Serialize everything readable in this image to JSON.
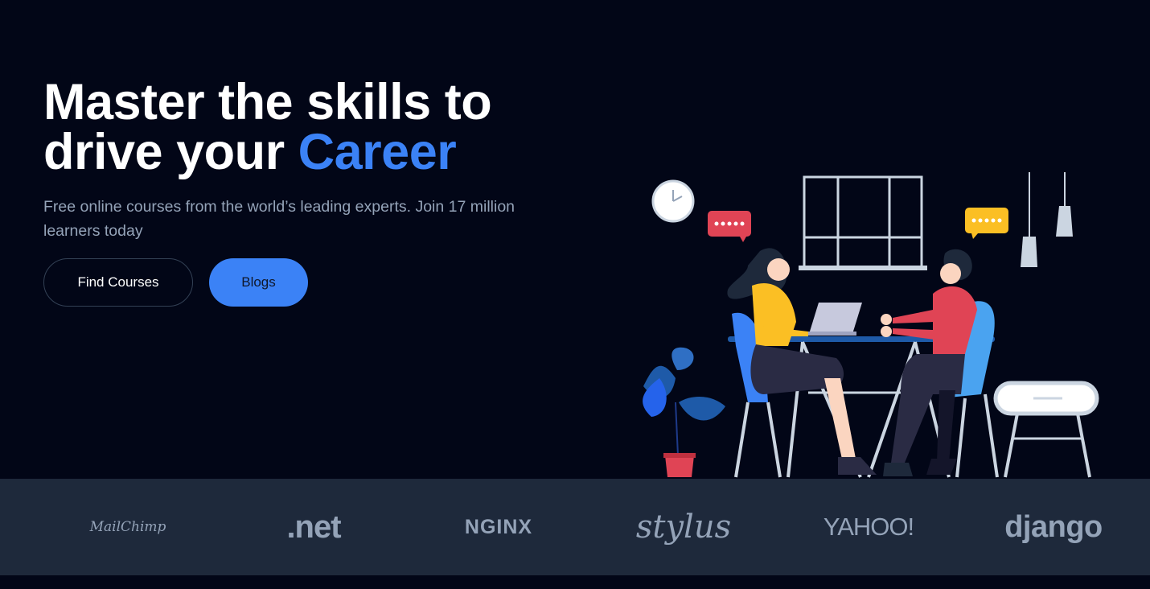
{
  "hero": {
    "headline_line1": "Master the skills to",
    "headline_line2_prefix": "drive your ",
    "headline_accent": "Career",
    "subtitle": "Free online courses from the world’s leading experts. Join 17 million learners today",
    "buttons": {
      "find_courses": "Find Courses",
      "blogs": "Blogs"
    }
  },
  "brands": [
    "MailChimp",
    ".net",
    "NGINX",
    "stylus",
    "YAHOO!",
    "django"
  ],
  "colors": {
    "background": "#020617",
    "accent": "#3b82f6",
    "brand_strip": "#1e293b",
    "muted_text": "#94a3b8"
  }
}
